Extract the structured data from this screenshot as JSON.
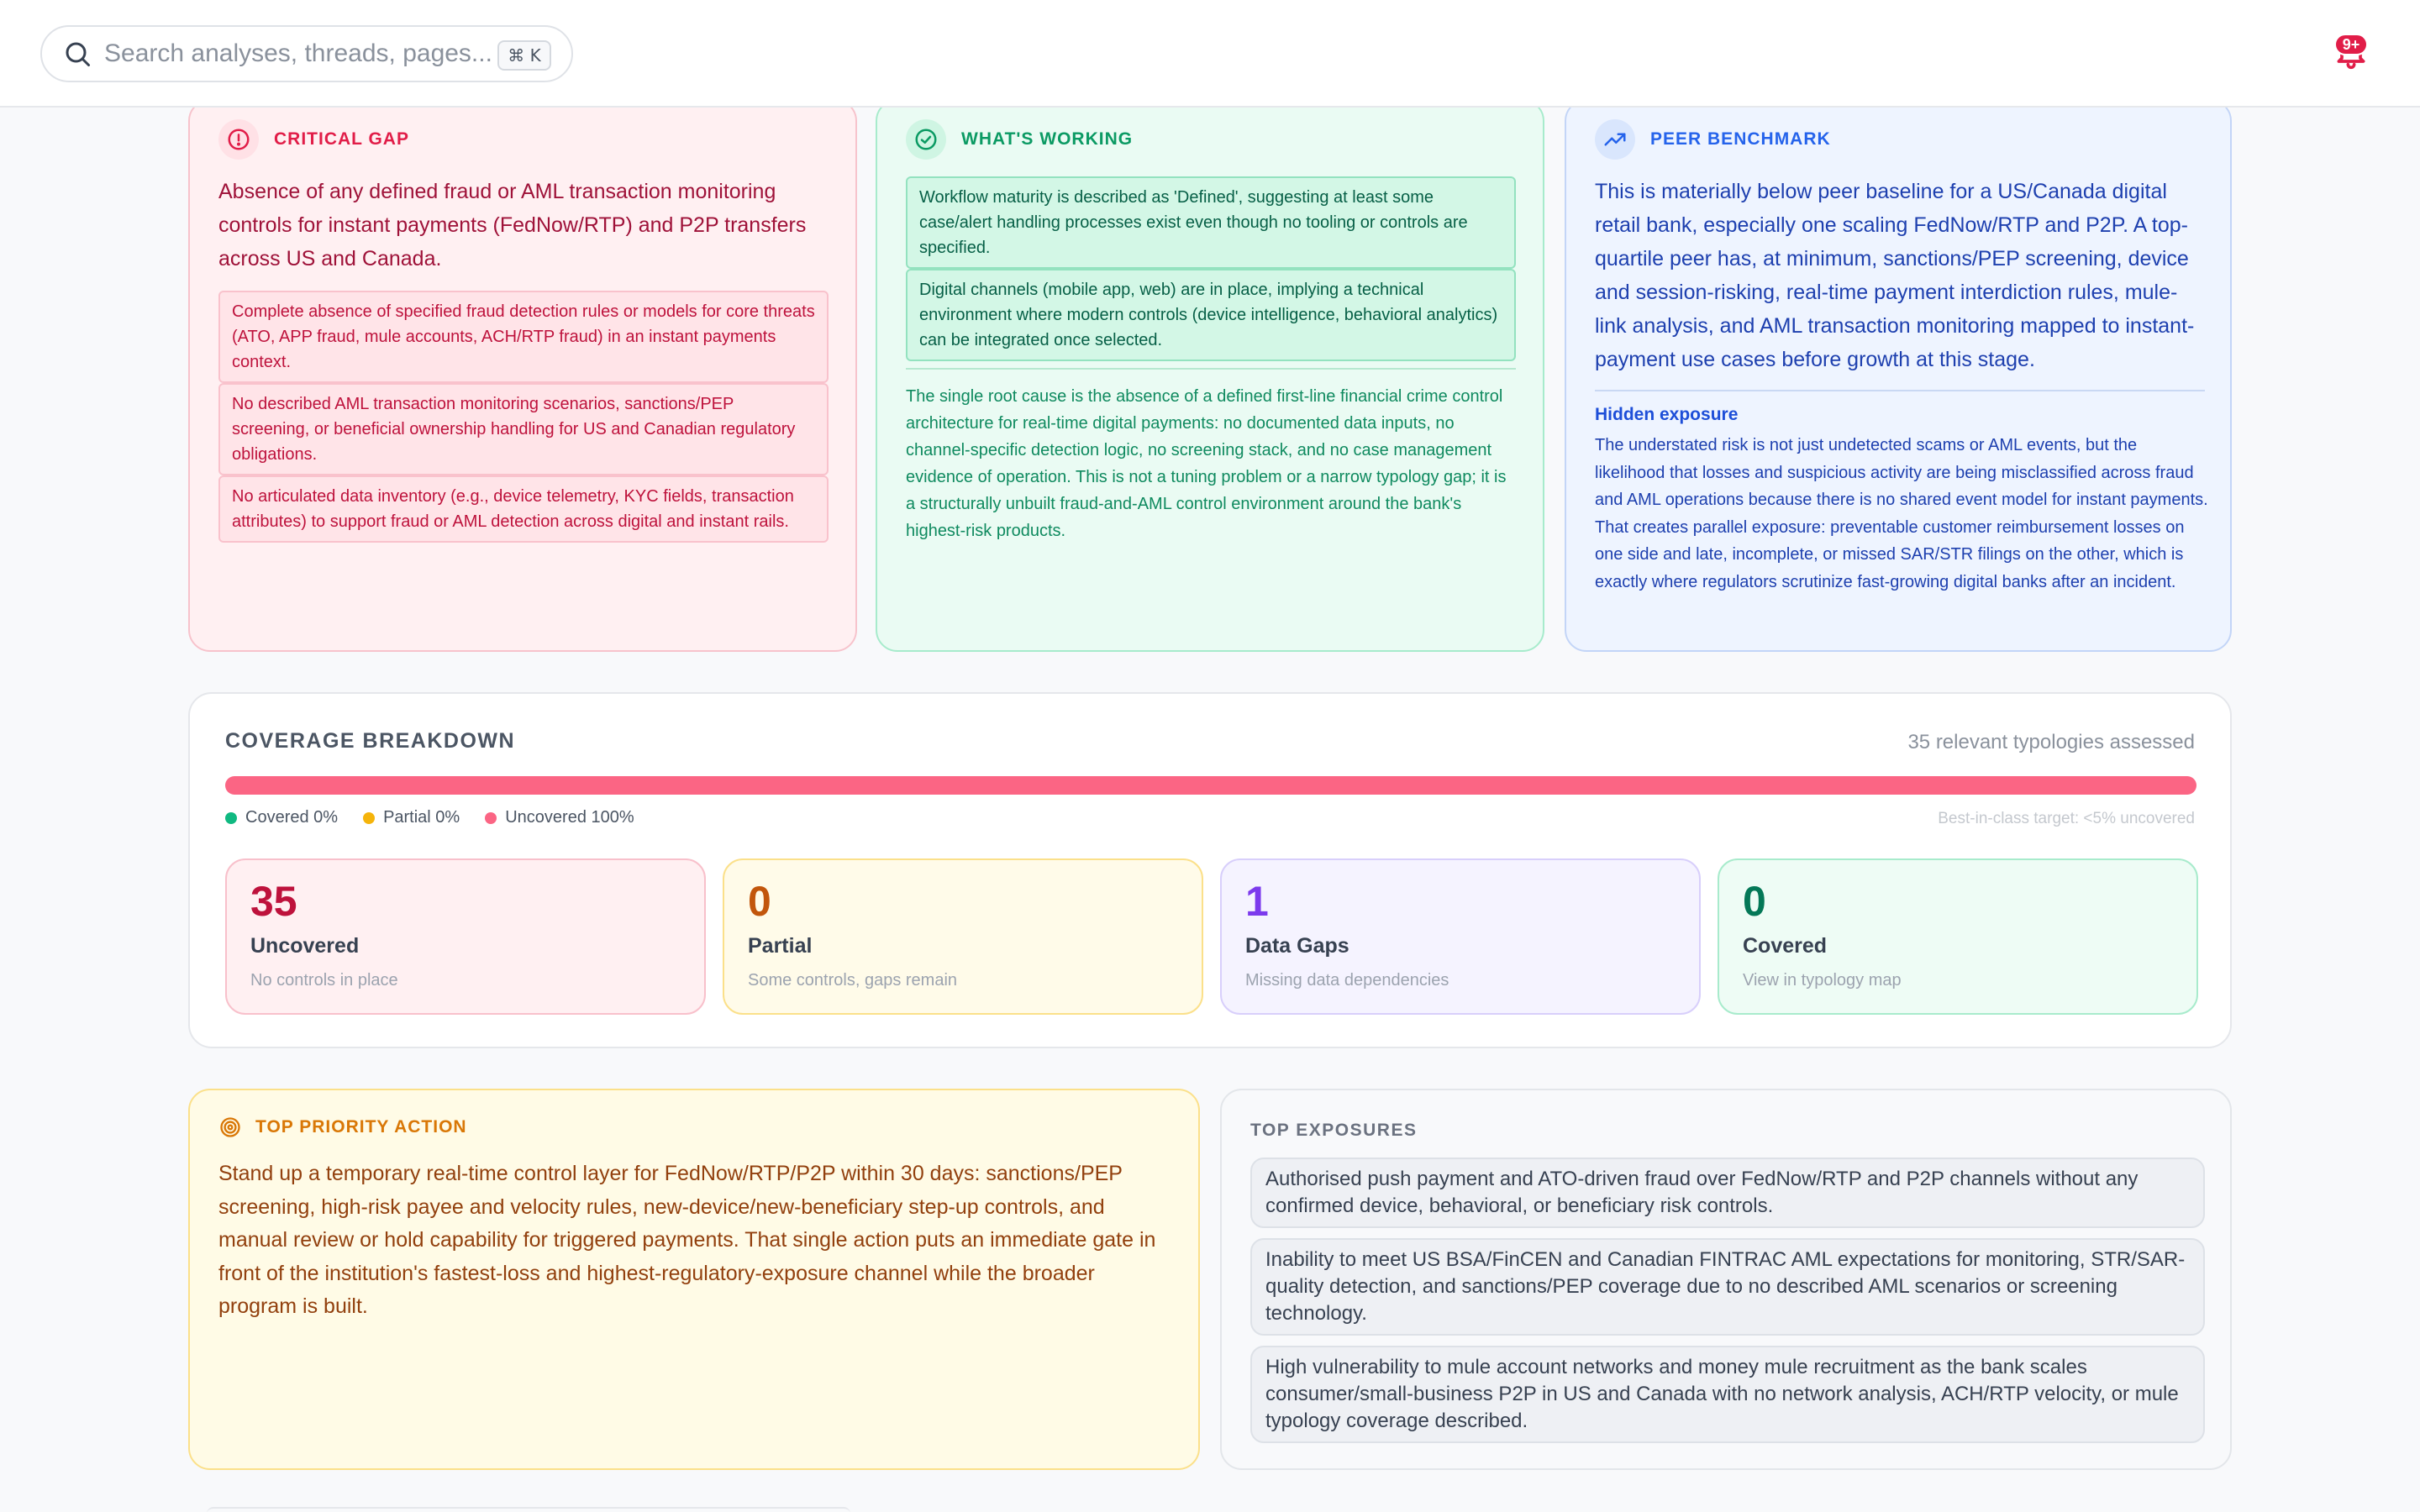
{
  "search": {
    "placeholder": "Search analyses, threads, pages...",
    "shortcut": "⌘ K"
  },
  "notifications": {
    "badge": "9+"
  },
  "critical_gap": {
    "label": "CRITICAL GAP",
    "summary": "Absence of any defined fraud or AML transaction monitoring controls for instant payments (FedNow/RTP) and P2P transfers across US and Canada.",
    "items": [
      "Complete absence of specified fraud detection rules or models for core threats (ATO, APP fraud, mule accounts, ACH/RTP fraud) in an instant payments context.",
      "No described AML transaction monitoring scenarios, sanctions/PEP screening, or beneficial ownership handling for US and Canadian regulatory obligations.",
      "No articulated data inventory (e.g., device telemetry, KYC fields, transaction attributes) to support fraud or AML detection across digital and instant rails."
    ]
  },
  "whats_working": {
    "label": "WHAT'S WORKING",
    "items": [
      "Workflow maturity is described as 'Defined', suggesting at least some case/alert handling processes exist even though no tooling or controls are specified.",
      "Digital channels (mobile app, web) are in place, implying a technical environment where modern controls (device intelligence, behavioral analytics) can be integrated once selected."
    ],
    "root_cause": "The single root cause is the absence of a defined first-line financial crime control architecture for real-time digital payments: no documented data inputs, no channel-specific detection logic, no screening stack, and no case management evidence of operation. This is not a tuning problem or a narrow typology gap; it is a structurally unbuilt fraud-and-AML control environment around the bank's highest-risk products."
  },
  "peer_benchmark": {
    "label": "PEER BENCHMARK",
    "summary": "This is materially below peer baseline for a US/Canada digital retail bank, especially one scaling FedNow/RTP and P2P. A top-quartile peer has, at minimum, sanctions/PEP screening, device and session-risking, real-time payment interdiction rules, mule-link analysis, and AML transaction monitoring mapped to instant-payment use cases before growth at this stage.",
    "hidden_title": "Hidden exposure",
    "hidden_text": "The understated risk is not just undetected scams or AML events, but the likelihood that losses and suspicious activity are being misclassified across fraud and AML operations because there is no shared event model for instant payments. That creates parallel exposure: preventable customer reimbursement losses on one side and late, incomplete, or missed SAR/STR filings on the other, which is exactly where regulators scrutinize fast-growing digital banks after an incident."
  },
  "coverage": {
    "title": "COVERAGE BREAKDOWN",
    "assessed": "35 relevant typologies assessed",
    "covered_pct": 0,
    "partial_pct": 0,
    "uncovered_pct": 100,
    "legend": {
      "covered": "Covered 0%",
      "partial": "Partial 0%",
      "uncovered": "Uncovered 100%"
    },
    "target": "Best-in-class target: <5% uncovered",
    "colors": {
      "covered": "#10b981",
      "partial": "#f5b40b",
      "uncovered": "#fb6584"
    },
    "stats": {
      "uncovered": {
        "value": "35",
        "label": "Uncovered",
        "desc": "No controls in place"
      },
      "partial": {
        "value": "0",
        "label": "Partial",
        "desc": "Some controls, gaps remain"
      },
      "data_gaps": {
        "value": "1",
        "label": "Data Gaps",
        "desc": "Missing data dependencies"
      },
      "covered": {
        "value": "0",
        "label": "Covered",
        "desc": "View in typology map"
      }
    }
  },
  "priority": {
    "label": "TOP PRIORITY ACTION",
    "text": "Stand up a temporary real-time control layer for FedNow/RTP/P2P within 30 days: sanctions/PEP screening, high-risk payee and velocity rules, new-device/new-beneficiary step-up controls, and manual review or hold capability for triggered payments. That single action puts an immediate gate in front of the institution's fastest-loss and highest-regulatory-exposure channel while the broader program is built."
  },
  "exposures": {
    "title": "TOP EXPOSURES",
    "items": [
      "Authorised push payment and ATO-driven fraud over FedNow/RTP and P2P channels without any confirmed device, behavioral, or beneficiary risk controls.",
      "Inability to meet US BSA/FinCEN and Canadian FINTRAC AML expectations for monitoring, STR/SAR-quality detection, and sanctions/PEP coverage due to no described AML scenarios or screening technology.",
      "High vulnerability to mule account networks and money mule recruitment as the bank scales consumer/small-business P2P in US and Canada with no network analysis, ACH/RTP velocity, or mule typology coverage described."
    ]
  }
}
